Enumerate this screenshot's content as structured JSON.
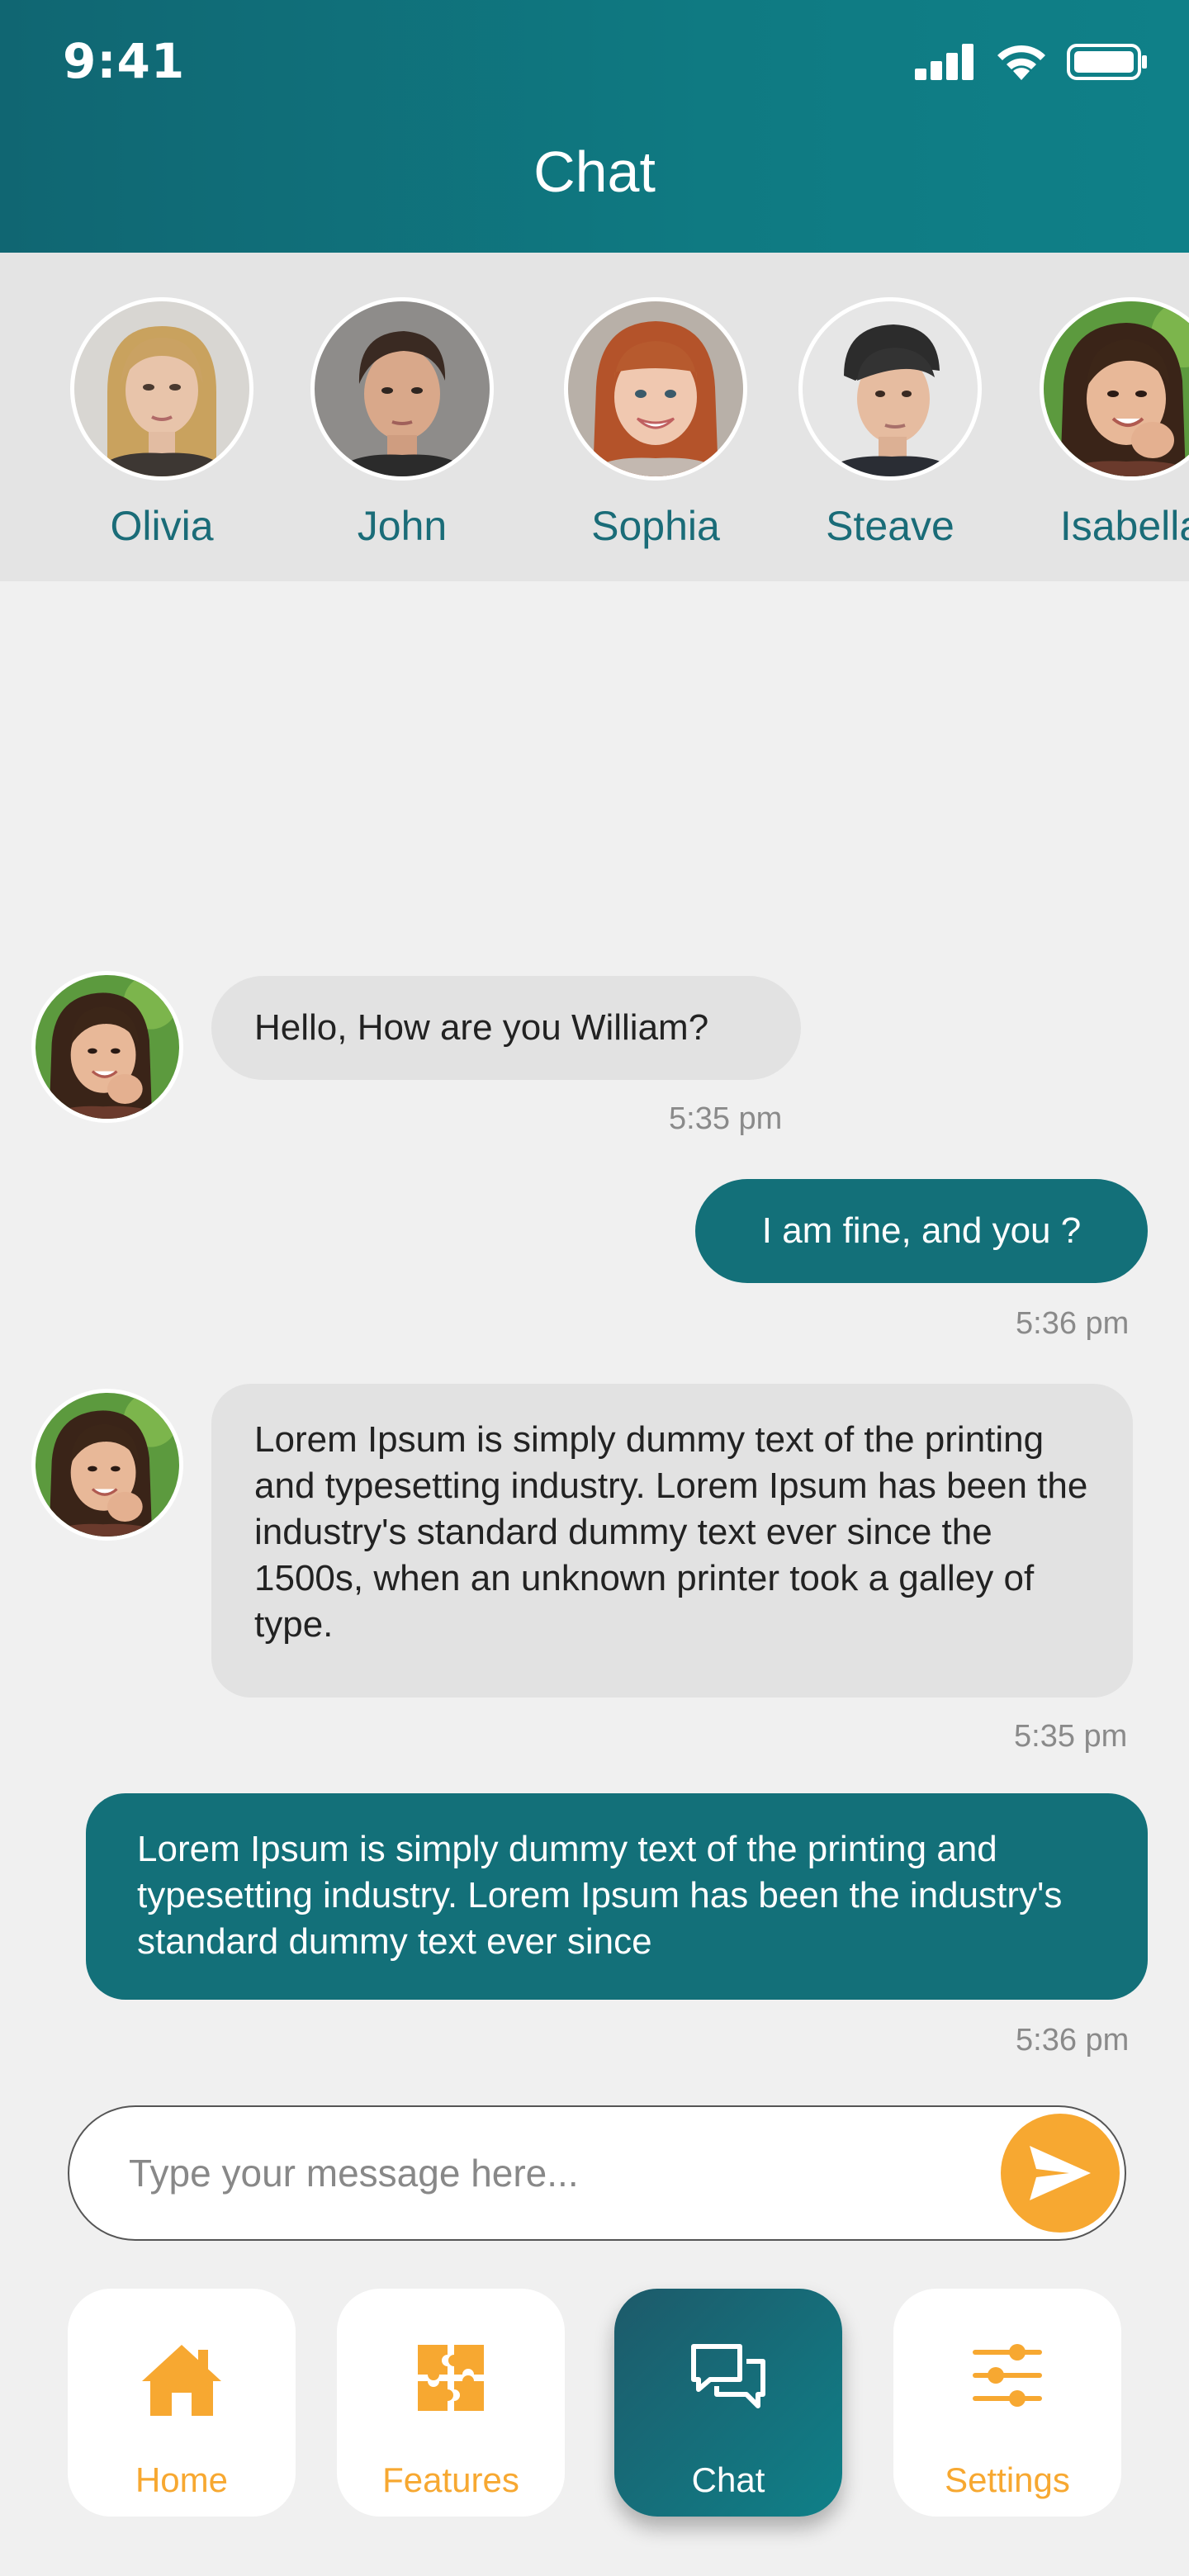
{
  "status_bar": {
    "time": "9:41"
  },
  "header": {
    "title": "Chat"
  },
  "contacts": [
    {
      "name": "Olivia"
    },
    {
      "name": "John"
    },
    {
      "name": "Sophia"
    },
    {
      "name": "Steave"
    },
    {
      "name": "Isabella"
    }
  ],
  "messages": [
    {
      "direction": "incoming",
      "text": "Hello, How are you William?",
      "time": "5:35 pm"
    },
    {
      "direction": "outgoing",
      "text": "I am fine, and you ?",
      "time": "5:36 pm"
    },
    {
      "direction": "incoming",
      "text": "Lorem Ipsum is simply dummy text of the printing and typesetting industry. Lorem Ipsum has been the industry's standard dummy text ever since the 1500s, when an unknown printer took a galley of type.",
      "time": "5:35 pm"
    },
    {
      "direction": "outgoing",
      "text": "Lorem Ipsum is simply dummy text of the printing and typesetting industry. Lorem Ipsum has been the industry's standard dummy text ever since",
      "time": "5:36 pm"
    }
  ],
  "composer": {
    "placeholder": "Type your message here...",
    "send_icon": "send-icon"
  },
  "nav": [
    {
      "label": "Home",
      "icon": "home-icon",
      "active": false
    },
    {
      "label": "Features",
      "icon": "puzzle-icon",
      "active": false
    },
    {
      "label": "Chat",
      "icon": "chat-bubbles-icon",
      "active": true
    },
    {
      "label": "Settings",
      "icon": "sliders-icon",
      "active": false
    }
  ],
  "colors": {
    "header": "#107379",
    "accent": "#f7a831",
    "outgoing_bubble": "#137079",
    "incoming_bubble": "#e2e2e2",
    "contact_name": "#1a6c78"
  }
}
